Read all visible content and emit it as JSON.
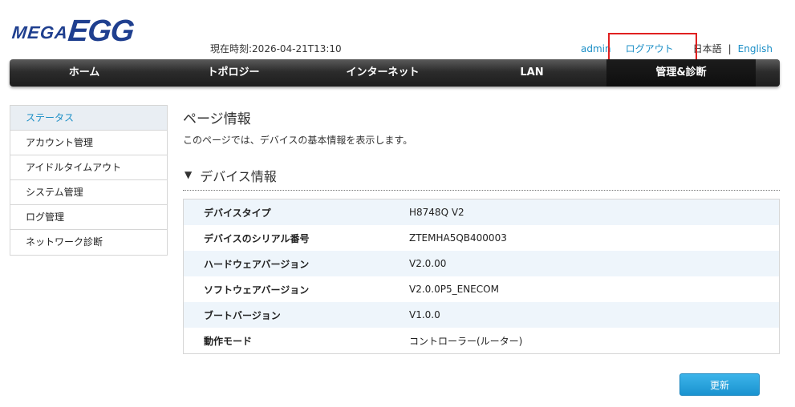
{
  "brand": {
    "mega": "MEGA",
    "egg": "EGG"
  },
  "header": {
    "time_label": "現在時刻:2026-04-21T13:10",
    "user": "admin",
    "logout": "ログアウト",
    "lang_ja": "日本語",
    "separator": "|",
    "lang_en": "English"
  },
  "nav": {
    "items": [
      {
        "label": "ホーム"
      },
      {
        "label": "トポロジー"
      },
      {
        "label": "インターネット"
      },
      {
        "label": "LAN"
      },
      {
        "label": "管理&診断",
        "active": true
      }
    ]
  },
  "sidebar": {
    "items": [
      {
        "label": "ステータス",
        "active": true
      },
      {
        "label": "アカウント管理"
      },
      {
        "label": "アイドルタイムアウト"
      },
      {
        "label": "システム管理"
      },
      {
        "label": "ログ管理"
      },
      {
        "label": "ネットワーク診断"
      }
    ]
  },
  "main": {
    "title": "ページ情報",
    "description": "このページでは、デバイスの基本情報を表示します。",
    "section_icon": "▼",
    "section_title": "デバイス情報",
    "rows": [
      {
        "key": "デバイスタイプ",
        "value": "H8748Q V2"
      },
      {
        "key": "デバイスのシリアル番号",
        "value": "ZTEMHA5QB400003"
      },
      {
        "key": "ハードウェアバージョン",
        "value": "V2.0.00"
      },
      {
        "key": "ソフトウェアバージョン",
        "value": "V2.0.0P5_ENECOM"
      },
      {
        "key": "ブートバージョン",
        "value": "V1.0.0"
      },
      {
        "key": "動作モード",
        "value": "コントローラー(ルーター)"
      }
    ],
    "refresh_label": "更新"
  },
  "colors": {
    "accent": "#1a8ec6",
    "highlight_box": "#e02020",
    "logo": "#1f3f8f",
    "row_alt": "#eef5fb"
  }
}
